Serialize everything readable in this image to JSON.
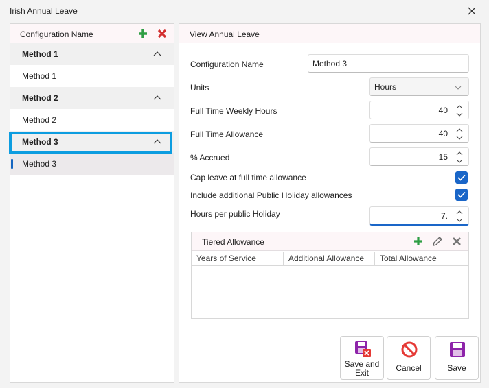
{
  "window": {
    "title": "Irish Annual Leave",
    "close_icon": "close-icon"
  },
  "left_panel": {
    "header": "Configuration Name",
    "add_icon": "plus-icon",
    "delete_icon": "x-icon",
    "groups": [
      {
        "label": "Method 1",
        "item": "Method 1"
      },
      {
        "label": "Method 2",
        "item": "Method 2"
      },
      {
        "label": "Method 3",
        "item": "Method 3"
      }
    ],
    "selected": "Method 3"
  },
  "right_panel": {
    "header": "View Annual Leave",
    "fields": {
      "config_name": {
        "label": "Configuration Name",
        "value": "Method 3"
      },
      "units": {
        "label": "Units",
        "value": "Hours"
      },
      "weekly_hours": {
        "label": "Full Time Weekly Hours",
        "value": "40"
      },
      "allowance": {
        "label": "Full Time Allowance",
        "value": "40"
      },
      "accrued": {
        "label": "% Accrued",
        "value": "15"
      },
      "cap_leave": {
        "label": "Cap leave at full time allowance",
        "checked": true
      },
      "include_ph": {
        "label": "Include additional Public Holiday allowances",
        "checked": true
      },
      "hours_ph": {
        "label": "Hours per public Holiday",
        "value": "7."
      }
    },
    "tiered": {
      "title": "Tiered Allowance",
      "columns": [
        "Years of Service",
        "Additional Allowance",
        "Total Allowance"
      ],
      "rows": []
    }
  },
  "buttons": {
    "save_exit": "Save and Exit",
    "cancel": "Cancel",
    "save": "Save"
  },
  "colors": {
    "accent": "#1a66c8",
    "focus_outline": "#0d9de0",
    "add_green": "#2e9e44",
    "delete_red": "#d32f2f",
    "save_purple": "#8e24aa"
  }
}
